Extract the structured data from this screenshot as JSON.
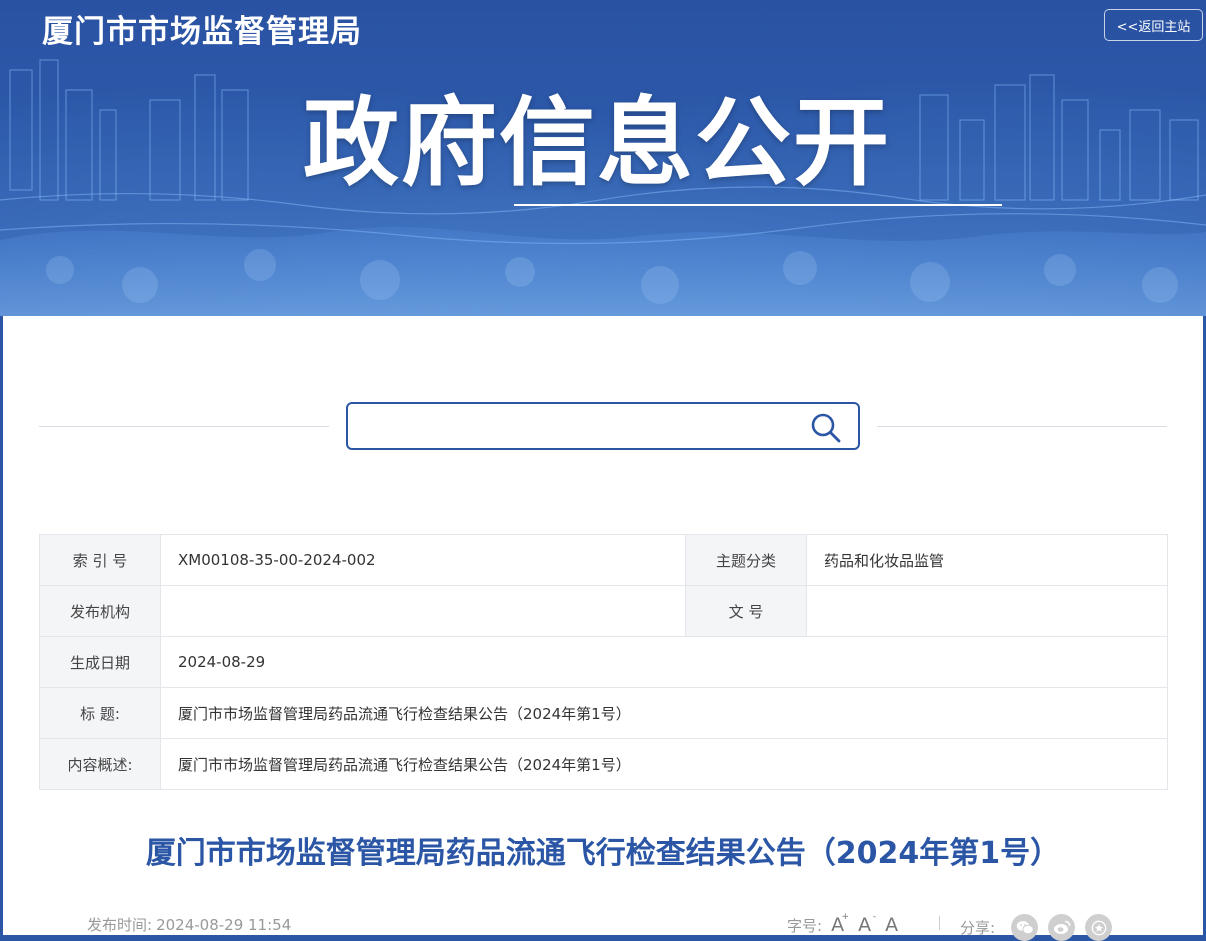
{
  "header": {
    "site_name": "厦门市市场监督管理局",
    "home_link": "<<返回主站",
    "hero_title": "政府信息公开"
  },
  "search": {
    "value": "",
    "placeholder": ""
  },
  "meta": {
    "index_label": "索 引 号",
    "index_value": "XM00108-35-00-2024-002",
    "topic_label": "主题分类",
    "topic_value": "药品和化妆品监管",
    "publisher_label": "发布机构",
    "publisher_value": "",
    "docno_label": "文 号",
    "docno_value": "",
    "date_label": "生成日期",
    "date_value": "2024-08-29",
    "title_label": "标 题:",
    "title_value": "厦门市市场监督管理局药品流通飞行检查结果公告（2024年第1号）",
    "summary_label": "内容概述:",
    "summary_value": "厦门市市场监督管理局药品流通飞行检查结果公告（2024年第1号）"
  },
  "article": {
    "title": "厦门市市场监督管理局药品流通飞行检查结果公告（2024年第1号）",
    "pub_label": "发布时间:",
    "pub_time": "2024-08-29 11:54",
    "font_label": "字号:",
    "font_large": "A",
    "font_large_sup": "+",
    "font_small": "A",
    "font_small_sup": "-",
    "font_default": "A",
    "share_label": "分享:"
  },
  "icons": {
    "search": "search-icon",
    "wechat": "wechat-icon",
    "weibo": "weibo-icon",
    "favorite": "star-icon"
  },
  "colors": {
    "brand_blue": "#2b56a6",
    "banner_blue": "#2d5aab",
    "label_bg": "#f4f5f7",
    "muted_text": "#999999"
  }
}
